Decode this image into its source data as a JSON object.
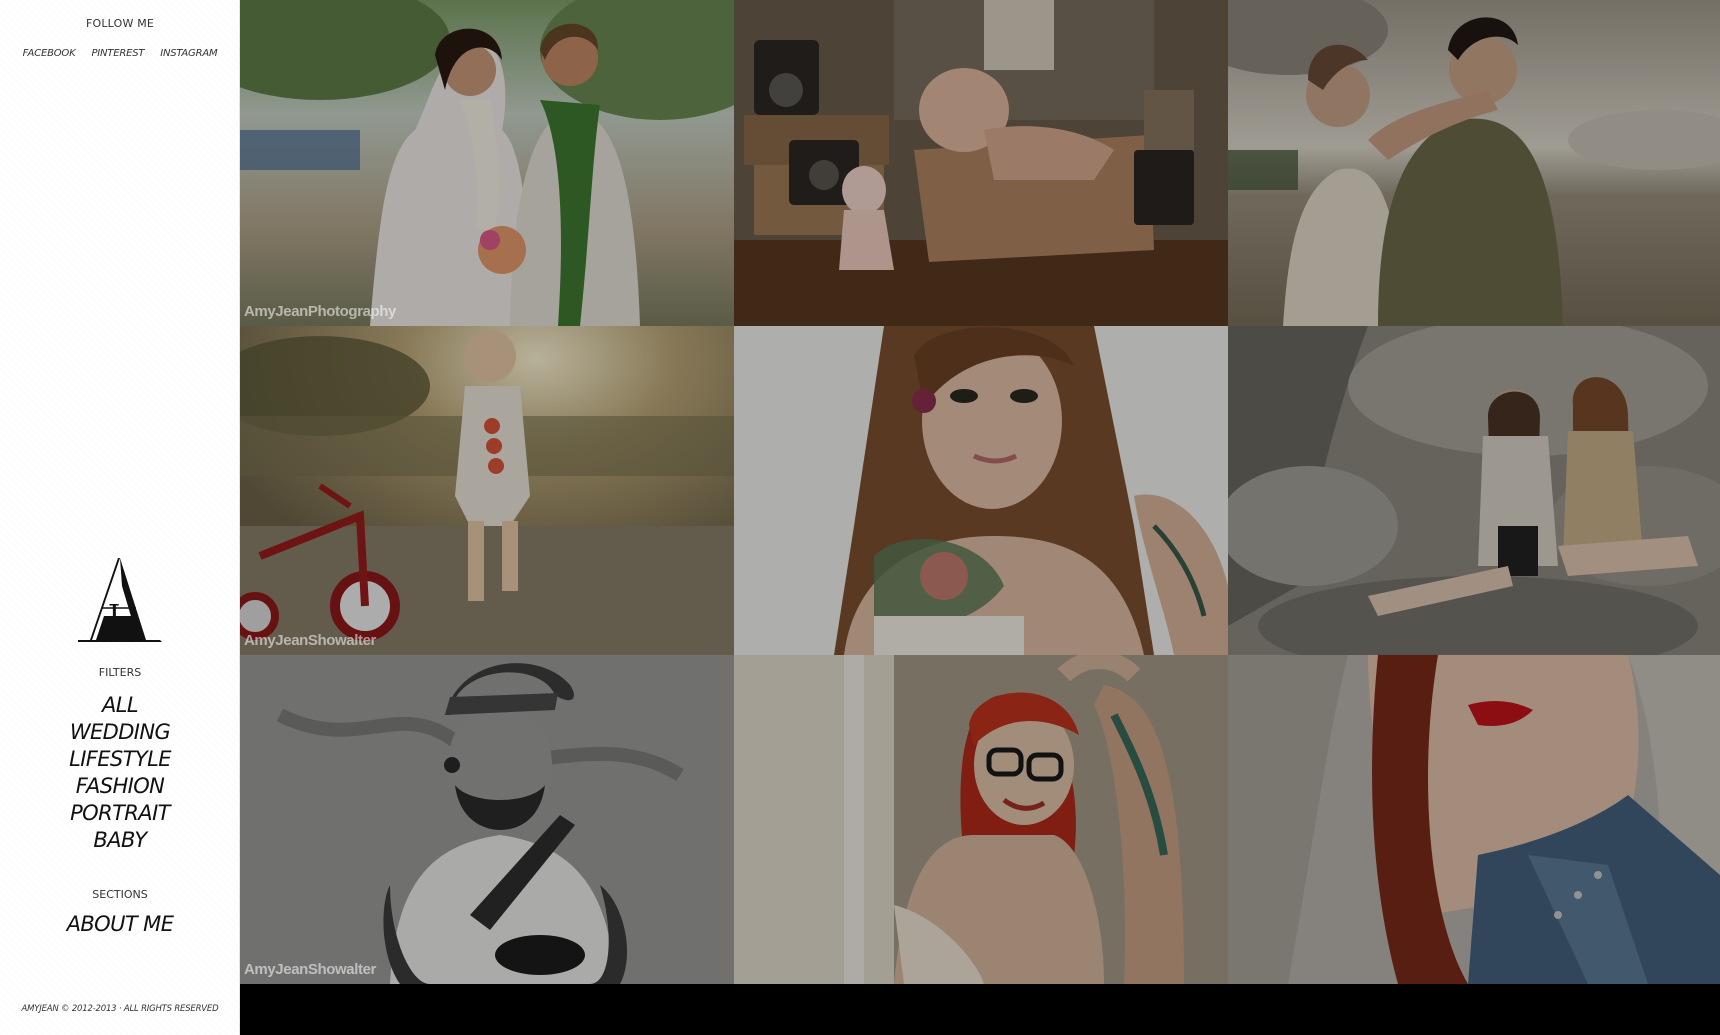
{
  "sidebar": {
    "follow_title": "FOLLOW ME",
    "social": [
      {
        "label": "FACEBOOK"
      },
      {
        "label": "PINTEREST"
      },
      {
        "label": "INSTAGRAM"
      }
    ],
    "logo_letters": "AJ",
    "filters_title": "FILTERS",
    "filters": [
      {
        "label": "ALL"
      },
      {
        "label": "WEDDING"
      },
      {
        "label": "LIFESTYLE"
      },
      {
        "label": "FASHION"
      },
      {
        "label": "PORTRAIT"
      },
      {
        "label": "BABY"
      }
    ],
    "sections_title": "SECTIONS",
    "about_label": "ABOUT ME",
    "copyright": "AMYJEAN © 2012-2013 · ALL RIGHTS RESERVED"
  },
  "gallery": {
    "tiles": [
      {
        "subject": "wedding-couple-leis",
        "watermark": "AmyJeanPhotography"
      },
      {
        "subject": "baby-in-suitcase-with-vintage-cameras",
        "watermark": ""
      },
      {
        "subject": "couple-embrace-beach",
        "watermark": ""
      },
      {
        "subject": "toddler-with-tricycle-sunset",
        "watermark": "AmyJeanShowalter"
      },
      {
        "subject": "tattooed-woman-portrait",
        "watermark": ""
      },
      {
        "subject": "two-girls-on-rocks",
        "watermark": ""
      },
      {
        "subject": "bearded-man-with-camera-strap-bw",
        "watermark": "AmyJeanShowalter"
      },
      {
        "subject": "red-haired-woman-glasses",
        "watermark": ""
      },
      {
        "subject": "red-lips-denim-jacket",
        "watermark": ""
      }
    ]
  },
  "colors": {
    "sidebar_bg": "#ffffff",
    "page_bg": "#000000",
    "overlay": "#000000"
  }
}
